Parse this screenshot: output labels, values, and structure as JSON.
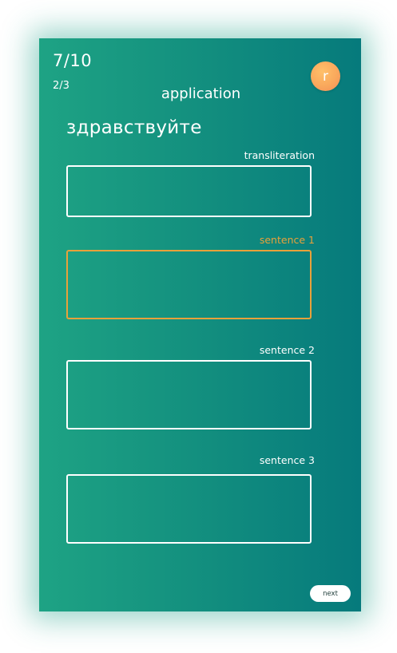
{
  "progress": {
    "main": "7/10",
    "sub": "2/3"
  },
  "user": {
    "avatar_letter": "r"
  },
  "section": {
    "title": "application"
  },
  "word": "здравствуйте",
  "fields": [
    {
      "label": "transliteration",
      "value": "",
      "active": false
    },
    {
      "label": "sentence 1",
      "value": "",
      "active": true
    },
    {
      "label": "sentence 2",
      "value": "",
      "active": false
    },
    {
      "label": "sentence 3",
      "value": "",
      "active": false
    }
  ],
  "actions": {
    "next_label": "next"
  },
  "colors": {
    "gradient_start": "#1ea384",
    "gradient_end": "#067a7c",
    "active_accent": "#e8a13a",
    "avatar_orange": "#f9a85c"
  }
}
